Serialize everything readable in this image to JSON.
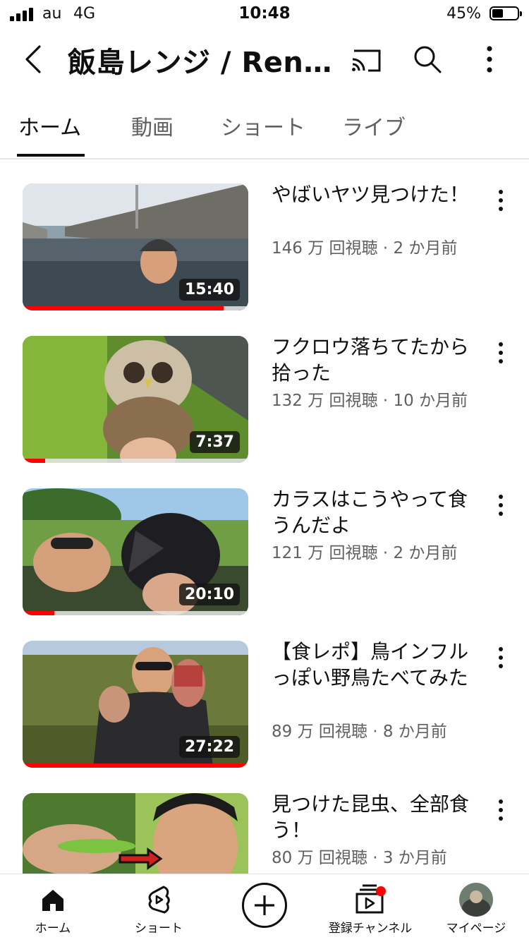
{
  "status_bar": {
    "carrier": "au",
    "network": "4G",
    "time": "10:48",
    "battery": "45%"
  },
  "header": {
    "channel_title": "飯島レンジ / Renj...",
    "icons": [
      "back-icon",
      "cast-icon",
      "search-icon",
      "more-vert-icon"
    ]
  },
  "tabs": [
    {
      "label": "ホーム",
      "active": true
    },
    {
      "label": "動画",
      "active": false
    },
    {
      "label": "ショート",
      "active": false
    },
    {
      "label": "ライブ",
      "active": false
    }
  ],
  "videos": [
    {
      "title": "やばいヤツ見つけた！",
      "meta": "146 万 回視聴 · 2 か月前",
      "duration": "15:40",
      "watched": 0.89
    },
    {
      "title": "フクロウ落ちてたから拾った",
      "meta": "132 万 回視聴 · 10 か月前",
      "duration": "7:37",
      "watched": 0.1
    },
    {
      "title": "カラスはこうやって食うんだよ",
      "meta": "121 万 回視聴 · 2 か月前",
      "duration": "20:10",
      "watched": 0.14
    },
    {
      "title": "【食レポ】鳥インフルっぽい野鳥たべてみた",
      "meta": "89 万 回視聴 · 8 か月前",
      "duration": "27:22",
      "watched": 1.0
    },
    {
      "title": "見つけた昆虫、全部食う！",
      "meta": "80 万 回視聴 · 3 か月前"
    }
  ],
  "bottom_nav": {
    "home": "ホーム",
    "shorts": "ショート",
    "subscriptions": "登録チャンネル",
    "mypage": "マイページ"
  },
  "colors": {
    "accent": "#ff0000",
    "text": "#0f0f0f",
    "secondary_text": "#606060"
  }
}
